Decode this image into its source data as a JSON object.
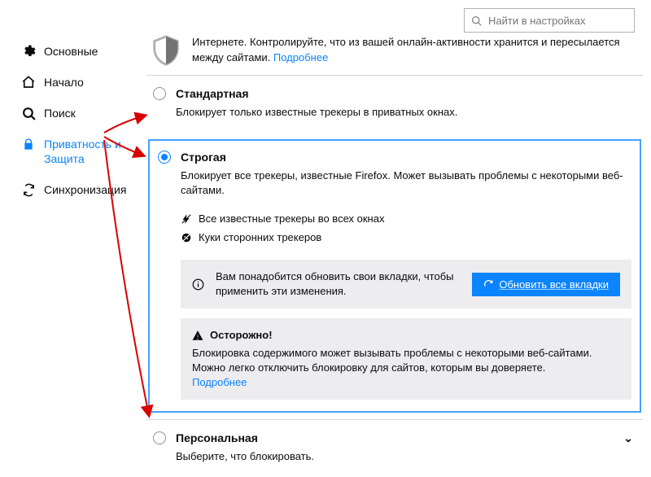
{
  "search": {
    "placeholder": "Найти в настройках"
  },
  "sidebar": {
    "items": [
      {
        "label": "Основные"
      },
      {
        "label": "Начало"
      },
      {
        "label": "Поиск"
      },
      {
        "label": "Приватность и Защита"
      },
      {
        "label": "Синхронизация"
      }
    ]
  },
  "intro": {
    "text_part1": "Интернете. Контролируйте, что из вашей онлайн-активности хранится и пересылается между сайтами.",
    "learn_more": "Подробнее"
  },
  "options": {
    "standard": {
      "title": "Стандартная",
      "desc": "Блокирует только известные трекеры в приватных окнах."
    },
    "strict": {
      "title": "Строгая",
      "desc": "Блокирует все трекеры, известные Firefox. Может вызывать проблемы с некоторыми веб-сайтами.",
      "feature1": "Все известные трекеры во всех окнах",
      "feature2": "Куки сторонних трекеров",
      "reload_notice": "Вам понадобится обновить свои вкладки, чтобы применить эти изменения.",
      "reload_button": "Обновить все вкладки",
      "warning_title": "Осторожно!",
      "warning_body": "Блокировка содержимого может вызывать проблемы с некоторыми веб-сайтами. Можно легко отключить блокировку для сайтов, которым вы доверяете.",
      "warning_link": "Подробнее"
    },
    "custom": {
      "title": "Персональная",
      "desc": "Выберите, что блокировать."
    }
  }
}
